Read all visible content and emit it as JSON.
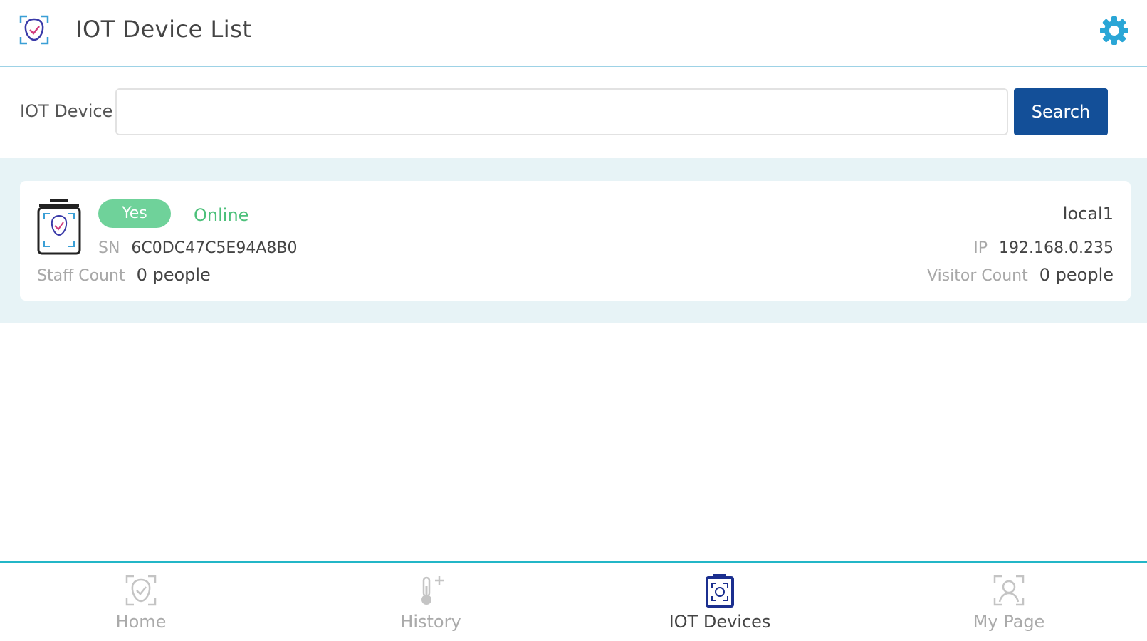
{
  "header": {
    "title": "IOT Device List",
    "logo_icon": "face-scan-icon",
    "settings_icon": "gear-icon"
  },
  "search": {
    "label": "IOT Device",
    "value": "",
    "placeholder": "",
    "button_label": "Search"
  },
  "devices": [
    {
      "icon": "device-terminal-icon",
      "badge": "Yes",
      "status": "Online",
      "name": "local1",
      "sn_label": "SN",
      "sn_value": "6C0DC47C5E94A8B0",
      "ip_label": "IP",
      "ip_value": "192.168.0.235",
      "staff_label": "Staff Count",
      "staff_value": "0 people",
      "visitor_label": "Visitor Count",
      "visitor_value": "0 people"
    }
  ],
  "nav": {
    "items": [
      {
        "label": "Home",
        "icon": "face-check-icon",
        "active": false
      },
      {
        "label": "History",
        "icon": "thermometer-plus-icon",
        "active": false
      },
      {
        "label": "IOT Devices",
        "icon": "device-terminal-icon",
        "active": true
      },
      {
        "label": "My Page",
        "icon": "user-icon",
        "active": false
      }
    ]
  },
  "colors": {
    "accent": "#134f98",
    "online": "#4cc07a",
    "badge": "#6fd29a",
    "nav_border": "#23b6c7",
    "header_border": "#9dd2e6",
    "list_bg": "#e7f3f6"
  }
}
